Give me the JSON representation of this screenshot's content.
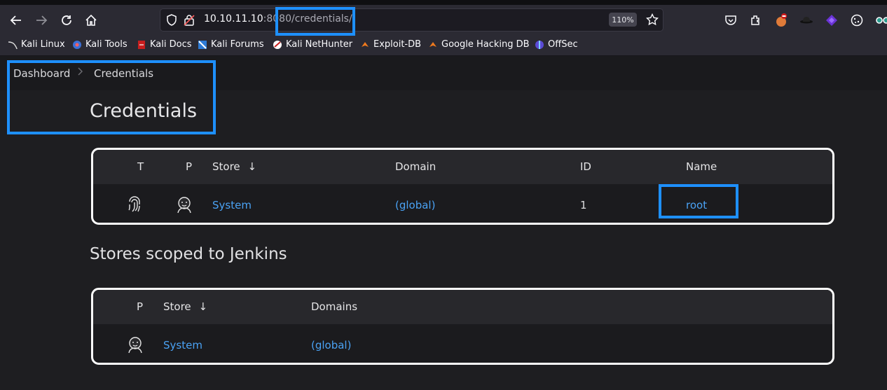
{
  "browser": {
    "url_host": "10.10.11.10",
    "url_port": ":808",
    "url_port_tail": "0",
    "url_path": "/credentials/",
    "zoom": "110%"
  },
  "bookmarks": [
    {
      "label": "Kali Linux",
      "icon": "kali-dragon-icon"
    },
    {
      "label": "Kali Tools",
      "icon": "kali-tools-icon"
    },
    {
      "label": "Kali Docs",
      "icon": "kali-docs-icon"
    },
    {
      "label": "Kali Forums",
      "icon": "kali-forums-icon"
    },
    {
      "label": "Kali NetHunter",
      "icon": "nethunter-icon"
    },
    {
      "label": "Exploit-DB",
      "icon": "exploitdb-icon"
    },
    {
      "label": "Google Hacking DB",
      "icon": "ghdb-icon"
    },
    {
      "label": "OffSec",
      "icon": "offsec-icon"
    }
  ],
  "breadcrumb": {
    "home": "Dashboard",
    "current": "Credentials"
  },
  "page_title": "Credentials",
  "credentials_table": {
    "headers": {
      "t": "T",
      "p": "P",
      "store": "Store",
      "sort": "↓",
      "domain": "Domain",
      "id": "ID",
      "name": "Name"
    },
    "rows": [
      {
        "store": "System",
        "domain": "(global)",
        "id": "1",
        "name": "root"
      }
    ]
  },
  "stores_title": "Stores scoped to Jenkins",
  "stores_table": {
    "headers": {
      "p": "P",
      "store": "Store",
      "sort": "↓",
      "domains": "Domains"
    },
    "rows": [
      {
        "store": "System",
        "domains": "(global)"
      }
    ]
  },
  "colors": {
    "link": "#4aa2f4",
    "highlight": "#1e90ff",
    "background": "#1e1e21"
  }
}
